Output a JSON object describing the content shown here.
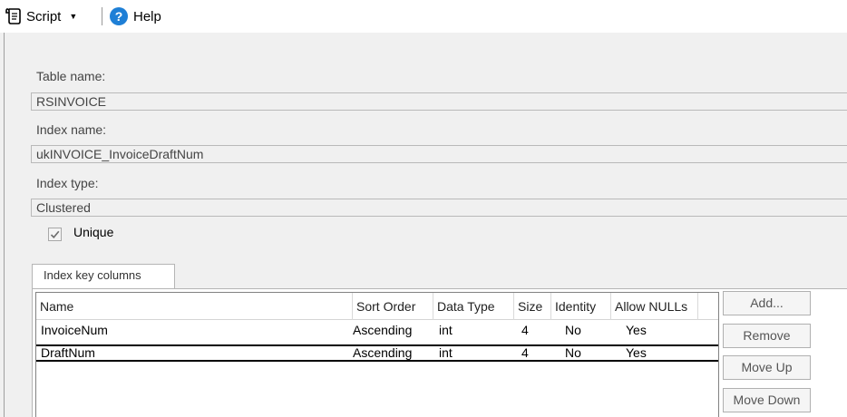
{
  "toolbar": {
    "script_label": "Script",
    "script_dropdown_glyph": "▼",
    "help_label": "Help",
    "help_glyph": "?"
  },
  "fields": {
    "table_name_label": "Table name:",
    "table_name_value": "RSINVOICE",
    "index_name_label": "Index name:",
    "index_name_value": "ukINVOICE_InvoiceDraftNum",
    "index_type_label": "Index type:",
    "index_type_value": "Clustered",
    "unique_label": "Unique",
    "unique_checked": true
  },
  "tabs": {
    "index_key_columns_label": "Index key columns"
  },
  "grid": {
    "columns": [
      "Name",
      "Sort Order",
      "Data Type",
      "Size",
      "Identity",
      "Allow NULLs"
    ],
    "rows": [
      {
        "name": "InvoiceNum",
        "sort_order": "Ascending",
        "data_type": "int",
        "size": "4",
        "identity": "No",
        "allow_nulls": "Yes"
      },
      {
        "name": "DraftNum",
        "sort_order": "Ascending",
        "data_type": "int",
        "size": "4",
        "identity": "No",
        "allow_nulls": "Yes"
      }
    ]
  },
  "buttons": {
    "add": "Add...",
    "remove": "Remove",
    "move_up": "Move Up",
    "move_down": "Move Down"
  },
  "colors": {
    "help_icon": "#1e7fd6",
    "background": "#f0f0f0"
  }
}
